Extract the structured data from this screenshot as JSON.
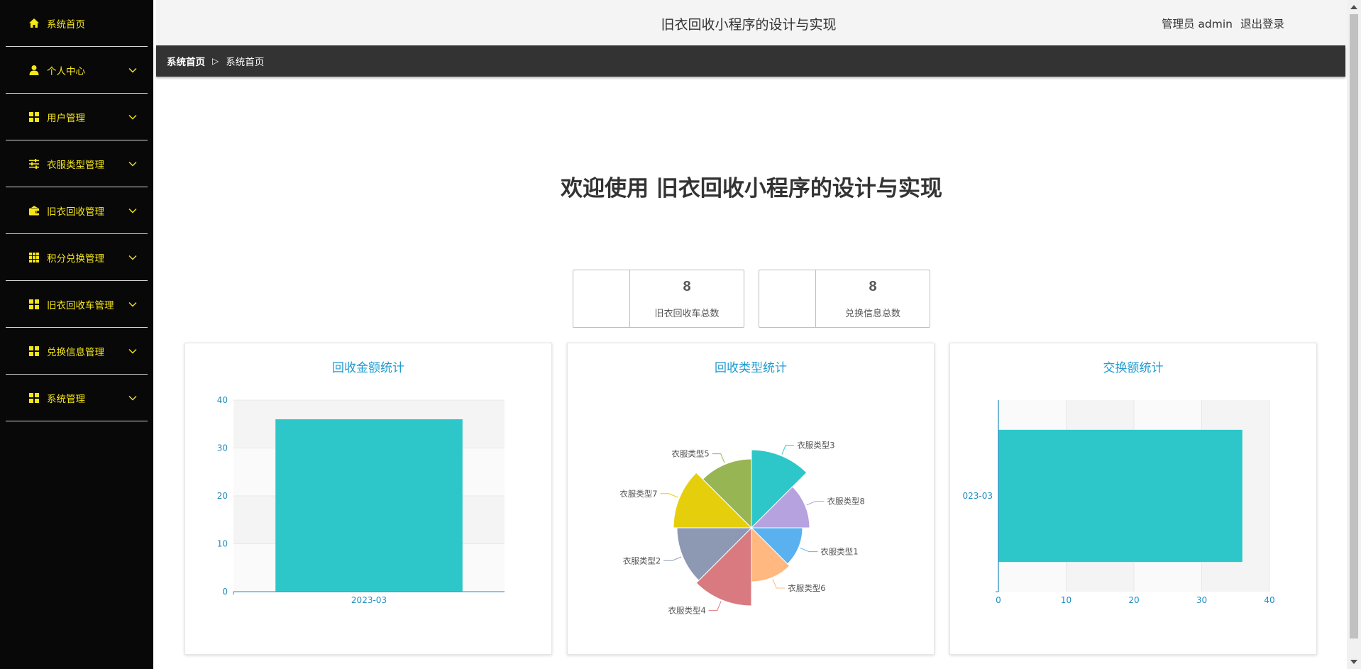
{
  "sidebar": {
    "items": [
      {
        "label": "系统首页",
        "icon": "home-icon",
        "expandable": false
      },
      {
        "label": "个人中心",
        "icon": "user-icon",
        "expandable": true
      },
      {
        "label": "用户管理",
        "icon": "grid-icon",
        "expandable": true
      },
      {
        "label": "衣服类型管理",
        "icon": "sliders-icon",
        "expandable": true
      },
      {
        "label": "旧衣回收管理",
        "icon": "wallet-icon",
        "expandable": true
      },
      {
        "label": "积分兑换管理",
        "icon": "table-icon",
        "expandable": true
      },
      {
        "label": "旧衣回收车管理",
        "icon": "grid-icon",
        "expandable": true
      },
      {
        "label": "兑换信息管理",
        "icon": "grid-icon",
        "expandable": true
      },
      {
        "label": "系统管理",
        "icon": "grid-icon",
        "expandable": true
      }
    ],
    "text_color": "#f5e617",
    "background": "#080808"
  },
  "header": {
    "title": "旧衣回收小程序的设计与实现",
    "admin": "管理员 admin",
    "logout": "退出登录"
  },
  "breadcrumb": {
    "items": [
      "系统首页",
      "系统首页"
    ],
    "separator": "▷"
  },
  "main": {
    "welcome": "欢迎使用 旧衣回收小程序的设计与实现",
    "stats": [
      {
        "value": "8",
        "label": "旧衣回收车总数"
      },
      {
        "value": "8",
        "label": "兑换信息总数"
      }
    ]
  },
  "chart_data": [
    {
      "type": "bar",
      "title": "回收金额统计",
      "categories": [
        "2023-03"
      ],
      "values": [
        36
      ],
      "ylim": [
        0,
        40
      ],
      "yticks": [
        "0",
        "10",
        "20",
        "30",
        "40"
      ],
      "color": "#2ec7c9",
      "grid": true
    },
    {
      "type": "pie",
      "title": "回收类型统计",
      "slices": [
        {
          "label": "衣服类型3",
          "value": 1,
          "color": "#2ec7c9"
        },
        {
          "label": "衣服类型8",
          "value": 1,
          "color": "#b6a2de"
        },
        {
          "label": "衣服类型1",
          "value": 1,
          "color": "#5ab1ef"
        },
        {
          "label": "衣服类型6",
          "value": 1,
          "color": "#ffb980"
        },
        {
          "label": "衣服类型4",
          "value": 1,
          "color": "#d87a80"
        },
        {
          "label": "衣服类型2",
          "value": 1,
          "color": "#8d98b3"
        },
        {
          "label": "衣服类型7",
          "value": 1,
          "color": "#e5cf0d"
        },
        {
          "label": "衣服类型5",
          "value": 1,
          "color": "#97b552"
        }
      ],
      "rose_type": "radius"
    },
    {
      "type": "bar",
      "orientation": "horizontal",
      "title": "交换额统计",
      "categories": [
        "023-03"
      ],
      "values": [
        36
      ],
      "xlim": [
        0,
        40
      ],
      "xticks": [
        "0",
        "10",
        "20",
        "30",
        "40"
      ],
      "color": "#2ec7c9",
      "grid": true
    }
  ]
}
